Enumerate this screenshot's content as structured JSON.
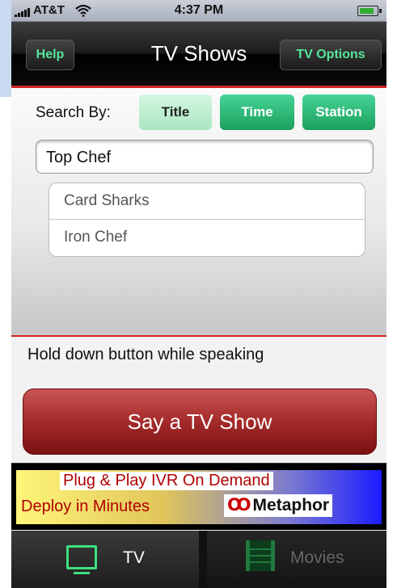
{
  "status_bar": {
    "carrier": "AT&T",
    "time": "4:37 PM",
    "battery_level": 0.85
  },
  "nav": {
    "title": "TV Shows",
    "help_label": "Help",
    "options_label": "TV Options"
  },
  "search": {
    "label": "Search By:",
    "segments": [
      "Title",
      "Time",
      "Station"
    ],
    "selected_segment": "Title",
    "value": "Top Chef",
    "suggestions": [
      "Card Sharks",
      "Iron Chef"
    ]
  },
  "voice": {
    "hint": "Hold down button while speaking",
    "button_label": "Say a TV Show"
  },
  "ad": {
    "line1": "Plug & Play IVR On Demand",
    "line2": "Deploy in Minutes",
    "brand_mark": "Ꝏ",
    "brand": "Metaphor"
  },
  "tabs": [
    {
      "label": "TV",
      "icon": "tv-icon"
    },
    {
      "label": "Movies",
      "icon": "film-icon"
    }
  ],
  "selected_tab": "TV",
  "colors": {
    "accent_green": "#1c9f5c",
    "nav_button_text": "#56e59a",
    "divider_red": "#d32424",
    "primary_button": "#a52a2a"
  }
}
